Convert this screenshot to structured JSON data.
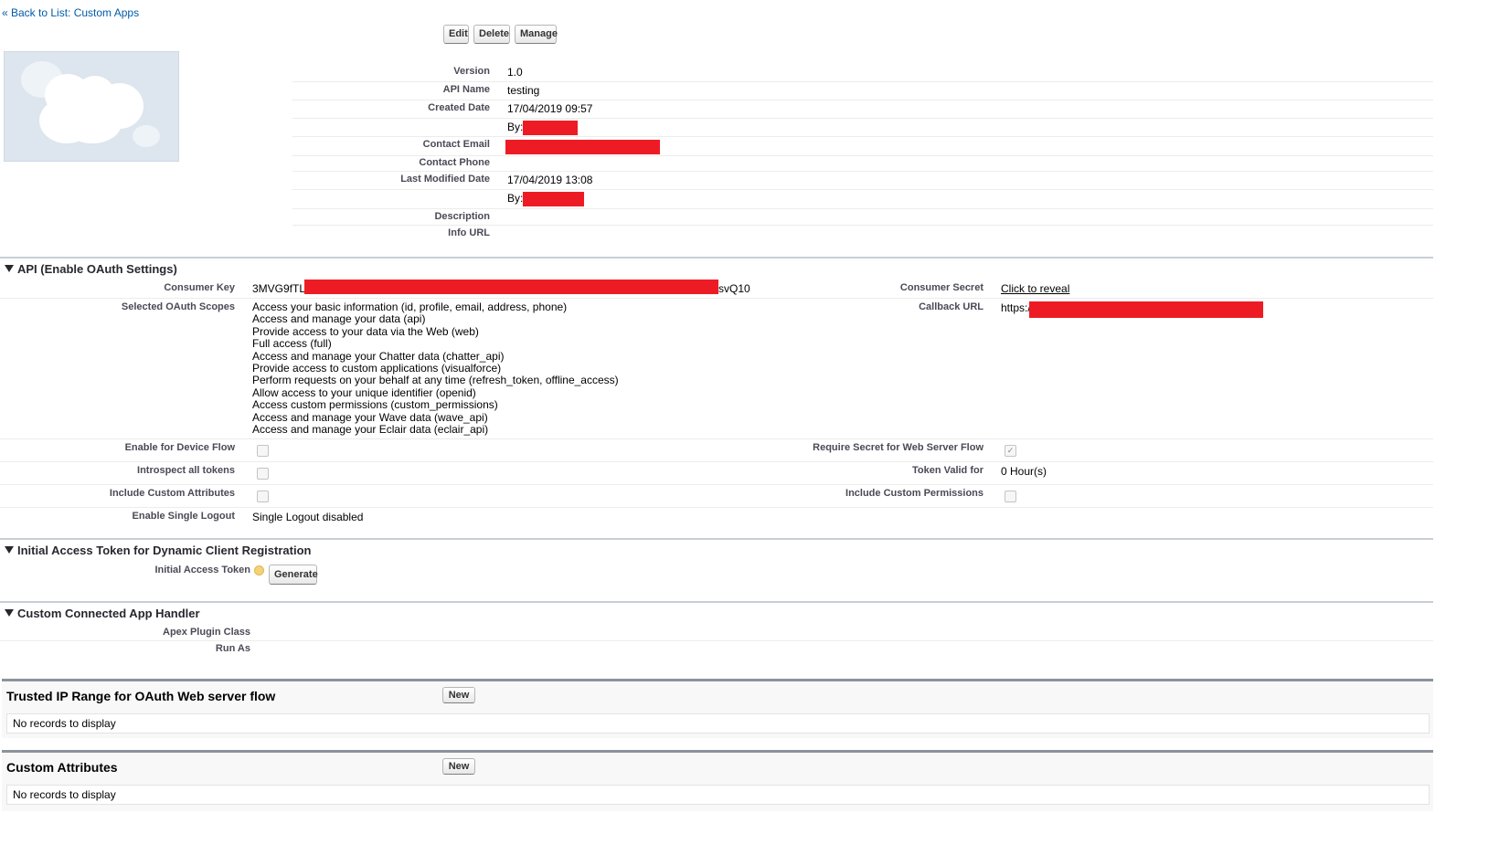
{
  "nav": {
    "back_link": "« Back to List: Custom Apps"
  },
  "toolbar": {
    "edit": "Edit",
    "delete": "Delete",
    "manage": "Manage"
  },
  "detail": {
    "version_label": "Version",
    "version": "1.0",
    "api_name_label": "API Name",
    "api_name": "testing",
    "created_label": "Created Date",
    "created": "17/04/2019 09:57",
    "created_by": "By:",
    "contact_email_label": "Contact Email",
    "contact_phone_label": "Contact Phone",
    "modified_label": "Last Modified Date",
    "modified": "17/04/2019 13:08",
    "modified_by": "By:",
    "description_label": "Description",
    "info_url_label": "Info URL"
  },
  "api_section": {
    "title": "API (Enable OAuth Settings)",
    "consumer_key_label": "Consumer Key",
    "consumer_key_prefix": "3MVG9fTL",
    "consumer_key_suffix": "svQ10",
    "consumer_secret_label": "Consumer Secret",
    "consumer_secret_link": "Click to reveal",
    "scopes_label": "Selected OAuth Scopes",
    "scopes": [
      "Access your basic information (id, profile, email, address, phone)",
      "Access and manage your data (api)",
      "Provide access to your data via the Web (web)",
      "Full access (full)",
      "Access and manage your Chatter data (chatter_api)",
      "Provide access to custom applications (visualforce)",
      "Perform requests on your behalf at any time (refresh_token, offline_access)",
      "Allow access to your unique identifier (openid)",
      "Access custom permissions (custom_permissions)",
      "Access and manage your Wave data (wave_api)",
      "Access and manage your Eclair data (eclair_api)"
    ],
    "callback_label": "Callback URL",
    "callback_prefix": "https:/",
    "device_flow_label": "Enable for Device Flow",
    "require_secret_label": "Require Secret for Web Server Flow",
    "require_secret_checked": true,
    "introspect_label": "Introspect all tokens",
    "token_valid_label": "Token Valid for",
    "token_valid_value": "0 Hour(s)",
    "custom_attrs_label": "Include Custom Attributes",
    "custom_perms_label": "Include Custom Permissions",
    "single_logout_label": "Enable Single Logout",
    "single_logout_value": "Single Logout disabled"
  },
  "initial_token_section": {
    "title": "Initial Access Token for Dynamic Client Registration",
    "token_label": "Initial Access Token",
    "generate": "Generate"
  },
  "handler_section": {
    "title": "Custom Connected App Handler",
    "apex_label": "Apex Plugin Class",
    "run_as_label": "Run As"
  },
  "trusted_ip": {
    "title": "Trusted IP Range for OAuth Web server flow",
    "new": "New",
    "empty": "No records to display"
  },
  "custom_attributes": {
    "title": "Custom Attributes",
    "new": "New",
    "empty": "No records to display"
  },
  "colors": {
    "link": "#015ba7",
    "redaction": "#ed1c24",
    "section_rule": "#8c939c"
  }
}
